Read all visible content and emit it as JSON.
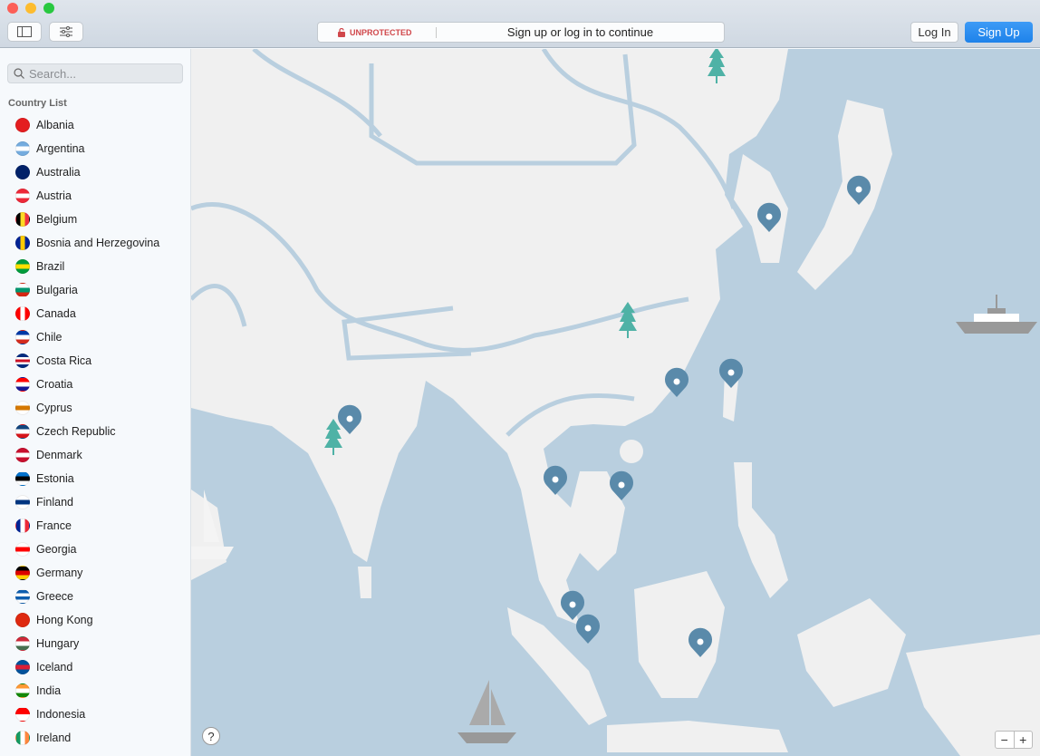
{
  "toolbar": {
    "status": "UNPROTECTED",
    "message": "Sign up or log in to continue",
    "login": "Log In",
    "signup": "Sign Up"
  },
  "sidebar": {
    "search_placeholder": "Search...",
    "list_title": "Country List",
    "countries": [
      {
        "name": "Albania",
        "colors": [
          "#e41e20",
          "#e41e20"
        ]
      },
      {
        "name": "Argentina",
        "colors": [
          "#74acdf",
          "#ffffff",
          "#74acdf"
        ]
      },
      {
        "name": "Australia",
        "colors": [
          "#012169",
          "#012169"
        ]
      },
      {
        "name": "Austria",
        "colors": [
          "#ed2939",
          "#ffffff",
          "#ed2939"
        ]
      },
      {
        "name": "Belgium",
        "colors": [
          "#000000",
          "#fdda24",
          "#ef3340"
        ],
        "v": true
      },
      {
        "name": "Bosnia and Herzegovina",
        "colors": [
          "#002395",
          "#fecb00",
          "#002395"
        ],
        "v": true
      },
      {
        "name": "Brazil",
        "colors": [
          "#009c3b",
          "#ffdf00",
          "#009c3b"
        ]
      },
      {
        "name": "Bulgaria",
        "colors": [
          "#ffffff",
          "#00966e",
          "#d62612"
        ]
      },
      {
        "name": "Canada",
        "colors": [
          "#ff0000",
          "#ffffff",
          "#ff0000"
        ],
        "v": true
      },
      {
        "name": "Chile",
        "colors": [
          "#0039a6",
          "#ffffff",
          "#d52b1e"
        ]
      },
      {
        "name": "Costa Rica",
        "colors": [
          "#002b7f",
          "#ffffff",
          "#ce1126",
          "#ffffff",
          "#002b7f"
        ]
      },
      {
        "name": "Croatia",
        "colors": [
          "#ff0000",
          "#ffffff",
          "#171796"
        ]
      },
      {
        "name": "Cyprus",
        "colors": [
          "#ffffff",
          "#d57800",
          "#ffffff"
        ]
      },
      {
        "name": "Czech Republic",
        "colors": [
          "#11457e",
          "#ffffff",
          "#d7141a"
        ]
      },
      {
        "name": "Denmark",
        "colors": [
          "#c8102e",
          "#ffffff",
          "#c8102e"
        ]
      },
      {
        "name": "Estonia",
        "colors": [
          "#0072ce",
          "#000000",
          "#ffffff"
        ]
      },
      {
        "name": "Finland",
        "colors": [
          "#ffffff",
          "#003580",
          "#ffffff"
        ]
      },
      {
        "name": "France",
        "colors": [
          "#002395",
          "#ffffff",
          "#ed2939"
        ],
        "v": true
      },
      {
        "name": "Georgia",
        "colors": [
          "#ffffff",
          "#ff0000",
          "#ffffff"
        ]
      },
      {
        "name": "Germany",
        "colors": [
          "#000000",
          "#dd0000",
          "#ffce00"
        ]
      },
      {
        "name": "Greece",
        "colors": [
          "#0d5eaf",
          "#ffffff",
          "#0d5eaf",
          "#ffffff"
        ]
      },
      {
        "name": "Hong Kong",
        "colors": [
          "#de2910",
          "#de2910"
        ]
      },
      {
        "name": "Hungary",
        "colors": [
          "#ce2939",
          "#ffffff",
          "#477050"
        ]
      },
      {
        "name": "Iceland",
        "colors": [
          "#02529c",
          "#dc1e35",
          "#02529c"
        ]
      },
      {
        "name": "India",
        "colors": [
          "#ff9933",
          "#ffffff",
          "#138808"
        ]
      },
      {
        "name": "Indonesia",
        "colors": [
          "#ff0000",
          "#ffffff"
        ]
      },
      {
        "name": "Ireland",
        "colors": [
          "#169b62",
          "#ffffff",
          "#ff883e"
        ],
        "v": true
      }
    ]
  },
  "map": {
    "help": "?",
    "zoom_out": "−",
    "zoom_in": "+"
  }
}
